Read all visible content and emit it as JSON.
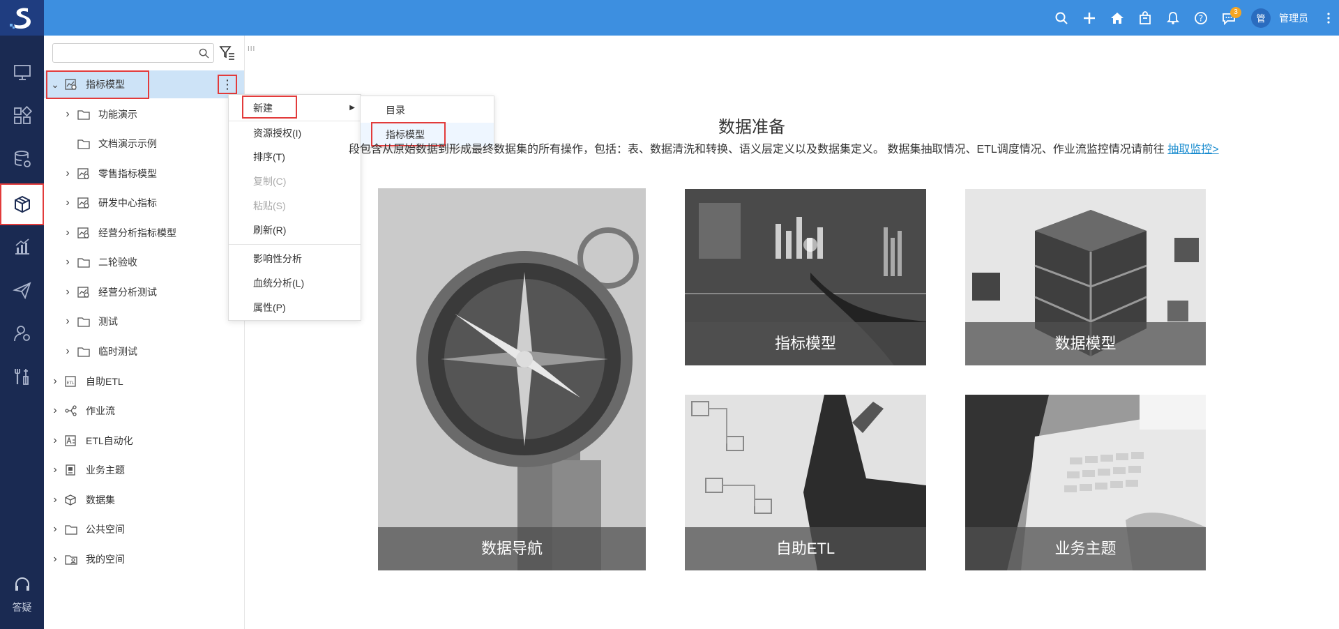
{
  "topbar": {
    "user_avatar": "管",
    "user_name": "管理员",
    "message_badge": "3",
    "icons": [
      "search-icon",
      "plus-icon",
      "home-icon",
      "bag-icon",
      "bell-icon",
      "help-icon",
      "chat-icon",
      "more-icon"
    ]
  },
  "sidenav": {
    "help_label": "答疑"
  },
  "tree": {
    "search_placeholder": "",
    "items": [
      {
        "label": "指标模型",
        "icon": "metric-model-icon",
        "expanded": true,
        "level": 0
      },
      {
        "label": "功能演示",
        "icon": "folder-icon",
        "level": 1
      },
      {
        "label": "文档演示示例",
        "icon": "folder-icon",
        "level": 1
      },
      {
        "label": "零售指标模型",
        "icon": "metric-model-icon",
        "level": 1
      },
      {
        "label": "研发中心指标",
        "icon": "metric-model-icon",
        "level": 1
      },
      {
        "label": "经营分析指标模型",
        "icon": "metric-model-icon",
        "level": 1
      },
      {
        "label": "二轮验收",
        "icon": "folder-icon",
        "level": 1
      },
      {
        "label": "经营分析测试",
        "icon": "metric-model-icon",
        "level": 1
      },
      {
        "label": "测试",
        "icon": "folder-icon",
        "level": 1
      },
      {
        "label": "临时测试",
        "icon": "folder-icon",
        "level": 1
      },
      {
        "label": "自助ETL",
        "icon": "etl-icon",
        "level": 0
      },
      {
        "label": "作业流",
        "icon": "workflow-icon",
        "level": 0
      },
      {
        "label": "ETL自动化",
        "icon": "etl-auto-icon",
        "level": 0
      },
      {
        "label": "业务主题",
        "icon": "business-theme-icon",
        "level": 0
      },
      {
        "label": "数据集",
        "icon": "dataset-icon",
        "level": 0
      },
      {
        "label": "公共空间",
        "icon": "folder-icon",
        "level": 0
      },
      {
        "label": "我的空间",
        "icon": "my-space-icon",
        "level": 0
      }
    ]
  },
  "context_menu": {
    "items": [
      {
        "label": "新建",
        "disabled": false
      },
      {
        "label": "资源授权(I)",
        "disabled": false
      },
      {
        "label": "排序(T)",
        "disabled": false
      },
      {
        "label": "复制(C)",
        "disabled": true
      },
      {
        "label": "粘贴(S)",
        "disabled": true
      },
      {
        "label": "刷新(R)",
        "disabled": false
      },
      {
        "label": "影响性分析",
        "disabled": false
      },
      {
        "label": "血统分析(L)",
        "disabled": false
      },
      {
        "label": "属性(P)",
        "disabled": false
      }
    ],
    "submenu": [
      "目录",
      "指标模型"
    ]
  },
  "main": {
    "title": "数据准备",
    "description": "段包含从原始数据到形成最终数据集的所有操作，包括：表、数据清洗和转换、语义层定义以及数据集定义。 数据集抽取情况、ETL调度情况、作业流监控情况请前往",
    "link_text": "抽取监控>",
    "cards": [
      {
        "label": "数据导航"
      },
      {
        "label": "指标模型"
      },
      {
        "label": "数据模型"
      },
      {
        "label": "自助ETL"
      },
      {
        "label": "业务主题"
      }
    ]
  },
  "colors": {
    "topbar": "#3d8fe0",
    "sidenav": "#1a2a52",
    "logo_bg": "#1f3d80",
    "highlight_box": "#e23b3b",
    "selected_row": "#cde3f7",
    "link": "#1a8ccf"
  }
}
